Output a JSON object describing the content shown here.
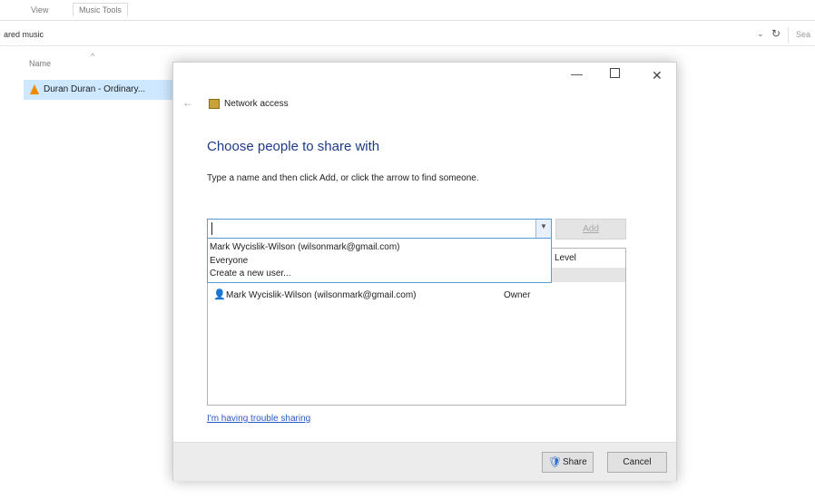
{
  "explorer": {
    "tabs": [
      "View",
      "Music Tools"
    ],
    "address": "ared music",
    "search_placeholder": "Sea",
    "column_name": "Name",
    "file_name": "Duran Duran - Ordinary..."
  },
  "dialog": {
    "title": "Network access",
    "heading": "Choose people to share with",
    "instruction": "Type a name and then click Add, or click the arrow to find someone.",
    "add_label": "Add",
    "dropdown_options": [
      "Mark Wycislik-Wilson (wilsonmark@gmail.com)",
      "Everyone",
      "Create a new user..."
    ],
    "table": {
      "level_header": "Level",
      "rows": [
        {
          "name": "Mark Wycislik-Wilson (wilsonmark@gmail.com)",
          "level": "Owner"
        }
      ]
    },
    "trouble_link": "I'm having trouble sharing",
    "share_label": "Share",
    "cancel_label": "Cancel"
  },
  "icons": {
    "close": "close-icon",
    "minimize": "minimize-icon",
    "maximize": "maximize-icon",
    "back": "back-arrow-icon",
    "shield": "uac-shield-icon",
    "user": "user-icon"
  }
}
